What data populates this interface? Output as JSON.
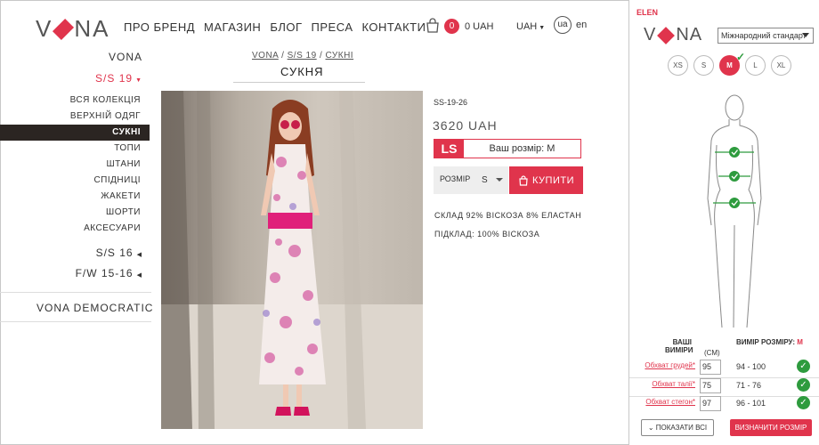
{
  "header": {
    "logo_left": "V",
    "logo_right": "NA",
    "nav": [
      "ПРО БРЕНД",
      "МАГАЗИН",
      "БЛОГ",
      "ПРЕСА",
      "КОНТАКТИ"
    ],
    "cart_count": "0",
    "cart_total": "0 UAH",
    "currency": "UAH",
    "lang_ua": "ua",
    "lang_en": "en"
  },
  "sidebar": {
    "brand": "VONA",
    "season_active": "S/S 19",
    "subitems": [
      "ВСЯ КОЛЕКЦІЯ",
      "ВЕРХНІЙ ОДЯГ",
      "СУКНІ",
      "ТОПИ",
      "ШТАНИ",
      "СПІДНИЦІ",
      "ЖАКЕТИ",
      "ШОРТИ",
      "АКСЕСУАРИ"
    ],
    "season2": "S/S 16",
    "season3": "F/W 15-16",
    "democratic": "VONA DEMOCRATIC"
  },
  "breadcrumb": {
    "items": [
      "VONA",
      "S/S 19",
      "СУКНІ"
    ]
  },
  "product": {
    "title": "СУКНЯ",
    "sku": "SS-19-26",
    "price": "3620 UAH",
    "ls_label": "LS",
    "your_size": "Ваш розмір: M",
    "size_label": "РОЗМІР",
    "size_value": "S",
    "buy_label": "КУПИТИ",
    "composition": "СКЛАД 92% ВІСКОЗА 8% ЕЛАСТАН",
    "lining": "ПІДКЛАД: 100% ВІСКОЗА"
  },
  "widget": {
    "user": "ELEN",
    "logo_left": "V",
    "logo_right": "NA",
    "standard": "Міжнародний стандарт",
    "sizes": [
      "XS",
      "S",
      "M",
      "L",
      "XL"
    ],
    "selected_size": "M",
    "col_yours": "ВАШІ ВИМІРИ",
    "col_unit": "(СМ)",
    "col_size": "ВИМІР РОЗМІРУ:",
    "col_size_val": "M",
    "rows": [
      {
        "label": "Обхват грудей*",
        "value": "95",
        "range": "94 - 100"
      },
      {
        "label": "Обхват талії*",
        "value": "75",
        "range": "71 - 76"
      },
      {
        "label": "Обхват стегон*",
        "value": "97",
        "range": "96 - 101"
      }
    ],
    "show_all": "ПОКАЗАТИ ВСІ",
    "determine": "ВИЗНАЧИТИ РОЗМІР"
  },
  "colors": {
    "accent": "#e0344c",
    "dark": "#2b2522",
    "ok": "#2e9b3e"
  }
}
